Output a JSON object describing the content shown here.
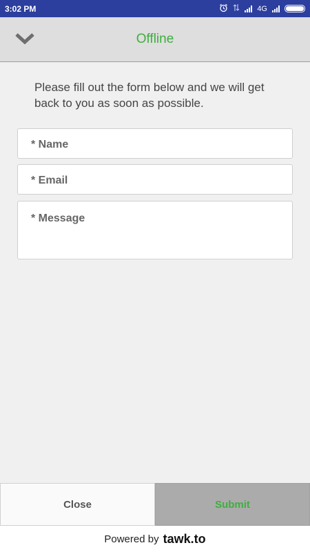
{
  "status_bar": {
    "time": "3:02 PM",
    "network": "4G"
  },
  "header": {
    "title": "Offline"
  },
  "form": {
    "intro": "Please fill out the form below and we will get back to you as soon as possible.",
    "name_placeholder": "* Name",
    "email_placeholder": "* Email",
    "message_placeholder": "* Message"
  },
  "buttons": {
    "close": "Close",
    "submit": "Submit"
  },
  "footer": {
    "powered_by": "Powered by",
    "brand": "tawk.to"
  },
  "colors": {
    "accent": "#3fae3f",
    "status_bar": "#2c3e9e"
  }
}
